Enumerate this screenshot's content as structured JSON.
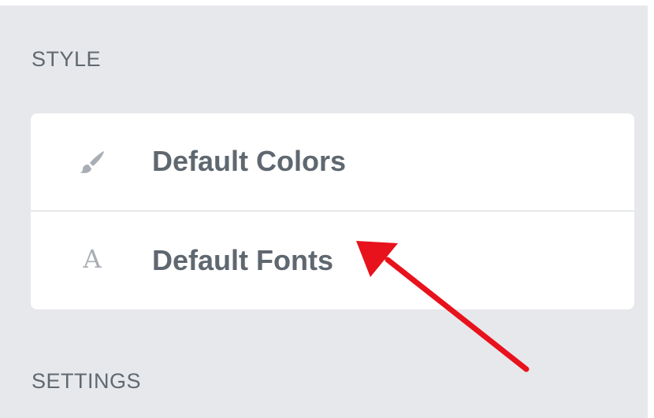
{
  "sections": {
    "style_title": "STYLE",
    "settings_title": "SETTINGS"
  },
  "style_menu": {
    "items": [
      {
        "label": "Default Colors",
        "icon": "paintbrush-icon"
      },
      {
        "label": "Default Fonts",
        "icon": "font-icon",
        "icon_glyph": "A"
      }
    ]
  },
  "annotation": {
    "arrow_color": "#e8121c",
    "points_to": "Default Fonts"
  },
  "colors": {
    "panel_background": "#e6e8eb",
    "card_background": "#ffffff",
    "label_text": "#5f6770",
    "icon": "#a9aeb4"
  }
}
